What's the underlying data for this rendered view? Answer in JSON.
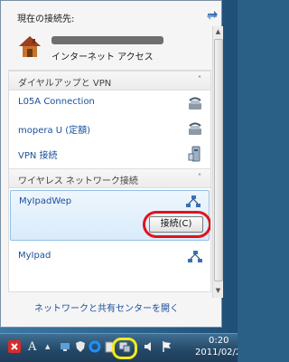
{
  "flyout": {
    "current_header": "現在の接続先:",
    "current_network": {
      "name_redacted": true,
      "access_label": "インターネット アクセス"
    },
    "footer_link": "ネットワークと共有センターを開く"
  },
  "sections": [
    {
      "title": "ダイヤルアップと VPN",
      "chevron": "˄",
      "items": [
        {
          "label": "L05A Connection",
          "icon": "phone-modem-icon"
        },
        {
          "label": "mopera U (定額)",
          "icon": "phone-modem-icon"
        },
        {
          "label": "VPN 接続",
          "icon": "vpn-computer-icon"
        }
      ]
    },
    {
      "title": "ワイヤレス ネットワーク接続",
      "chevron": "˄",
      "items": [
        {
          "label": "MyIpadWep",
          "icon": "adhoc-network-icon",
          "selected": true,
          "action_label": "接続(C)"
        },
        {
          "label": "MyIpad",
          "icon": "adhoc-network-icon"
        }
      ]
    }
  ],
  "taskbar": {
    "language_label": "A",
    "caret": "▲",
    "clock_time": "0:20",
    "clock_date": "2011/02/2"
  },
  "colors": {
    "link_blue": "#1a4f9c",
    "annotation_red": "#e0141b",
    "annotation_yellow": "#f3ea1a",
    "selection_bg": "#d9ebfb"
  }
}
